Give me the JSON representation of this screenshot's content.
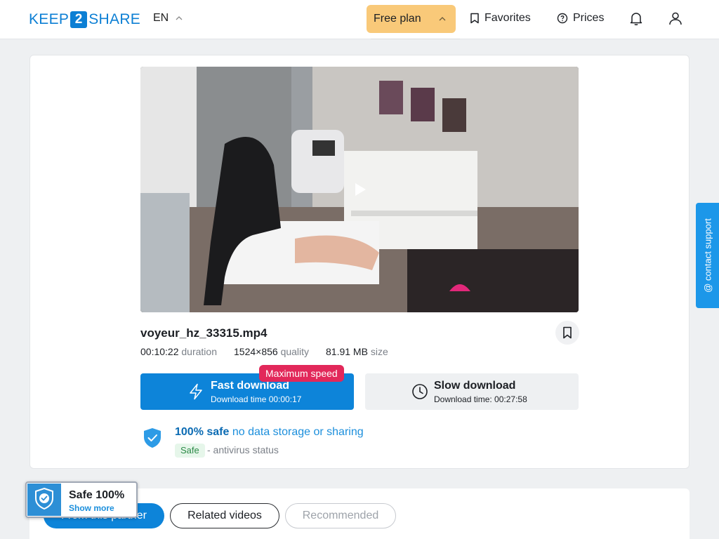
{
  "header": {
    "logo": {
      "left": "KEEP",
      "mid": "2",
      "right": "SHARE"
    },
    "language": "EN",
    "plan_label": "Free plan",
    "favorites_label": "Favorites",
    "prices_label": "Prices"
  },
  "file": {
    "name": "voyeur_hz_33315.mp4",
    "duration_value": "00:10:22",
    "duration_label": "duration",
    "quality_value": "1524×856",
    "quality_label": "quality",
    "size_value": "81.91 MB",
    "size_label": "size"
  },
  "download": {
    "fast_title": "Fast download",
    "fast_sub": "Download time 00:00:17",
    "max_badge": "Maximum speed",
    "slow_title": "Slow download",
    "slow_sub": "Download time: 00:27:58"
  },
  "safety": {
    "headline_bold": "100% safe",
    "headline_rest": "no data storage or sharing",
    "tag": "Safe",
    "status_text": "- antivirus status"
  },
  "contact_label": "@ contact support",
  "tabs": [
    {
      "label": "From this partner"
    },
    {
      "label": "Related videos"
    },
    {
      "label": "Recommended"
    }
  ],
  "safe_widget": {
    "title": "Safe 100%",
    "subtitle": "Show more"
  },
  "colors": {
    "brand": "#0c7fd4",
    "plan": "#f9c979",
    "badge": "#e2285a",
    "support": "#1c97e9"
  }
}
